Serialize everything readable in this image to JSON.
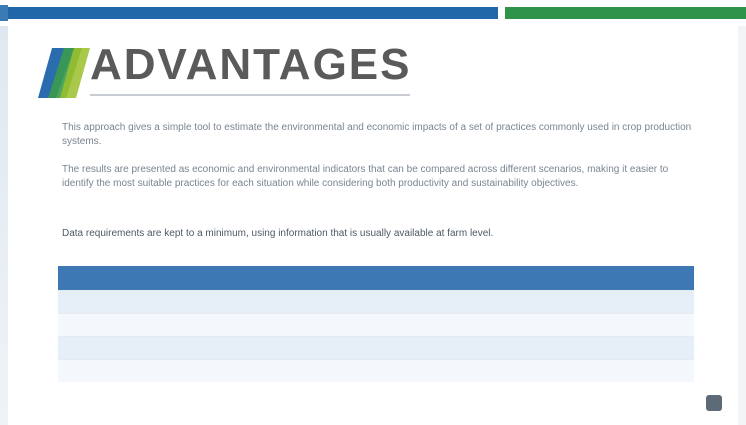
{
  "slide": {
    "title": "ADVANTAGES",
    "paragraphs": [
      "This approach gives a simple tool to estimate the environmental and economic impacts of a set of practices commonly used in crop production systems.",
      "The results are presented as economic and environmental indicators that can be compared across different scenarios, making it easier to identify the most suitable practices for each situation while considering both productivity and sustainability objectives.",
      "Data requirements are kept to a minimum, using information that is usually available at farm level."
    ],
    "table": {
      "headers": [
        "",
        "",
        "",
        ""
      ],
      "rows": [
        [
          "",
          "",
          "",
          ""
        ],
        [
          "",
          "",
          "",
          ""
        ],
        [
          "",
          "",
          "",
          ""
        ],
        [
          "",
          "",
          "",
          ""
        ]
      ]
    },
    "footer": {
      "brand": "",
      "right_label": ""
    }
  },
  "colors": {
    "top_blue": "#1f67a8",
    "top_green": "#2f9449",
    "table_header": "#3d78b5",
    "title_gray": "#5a5a5a"
  }
}
